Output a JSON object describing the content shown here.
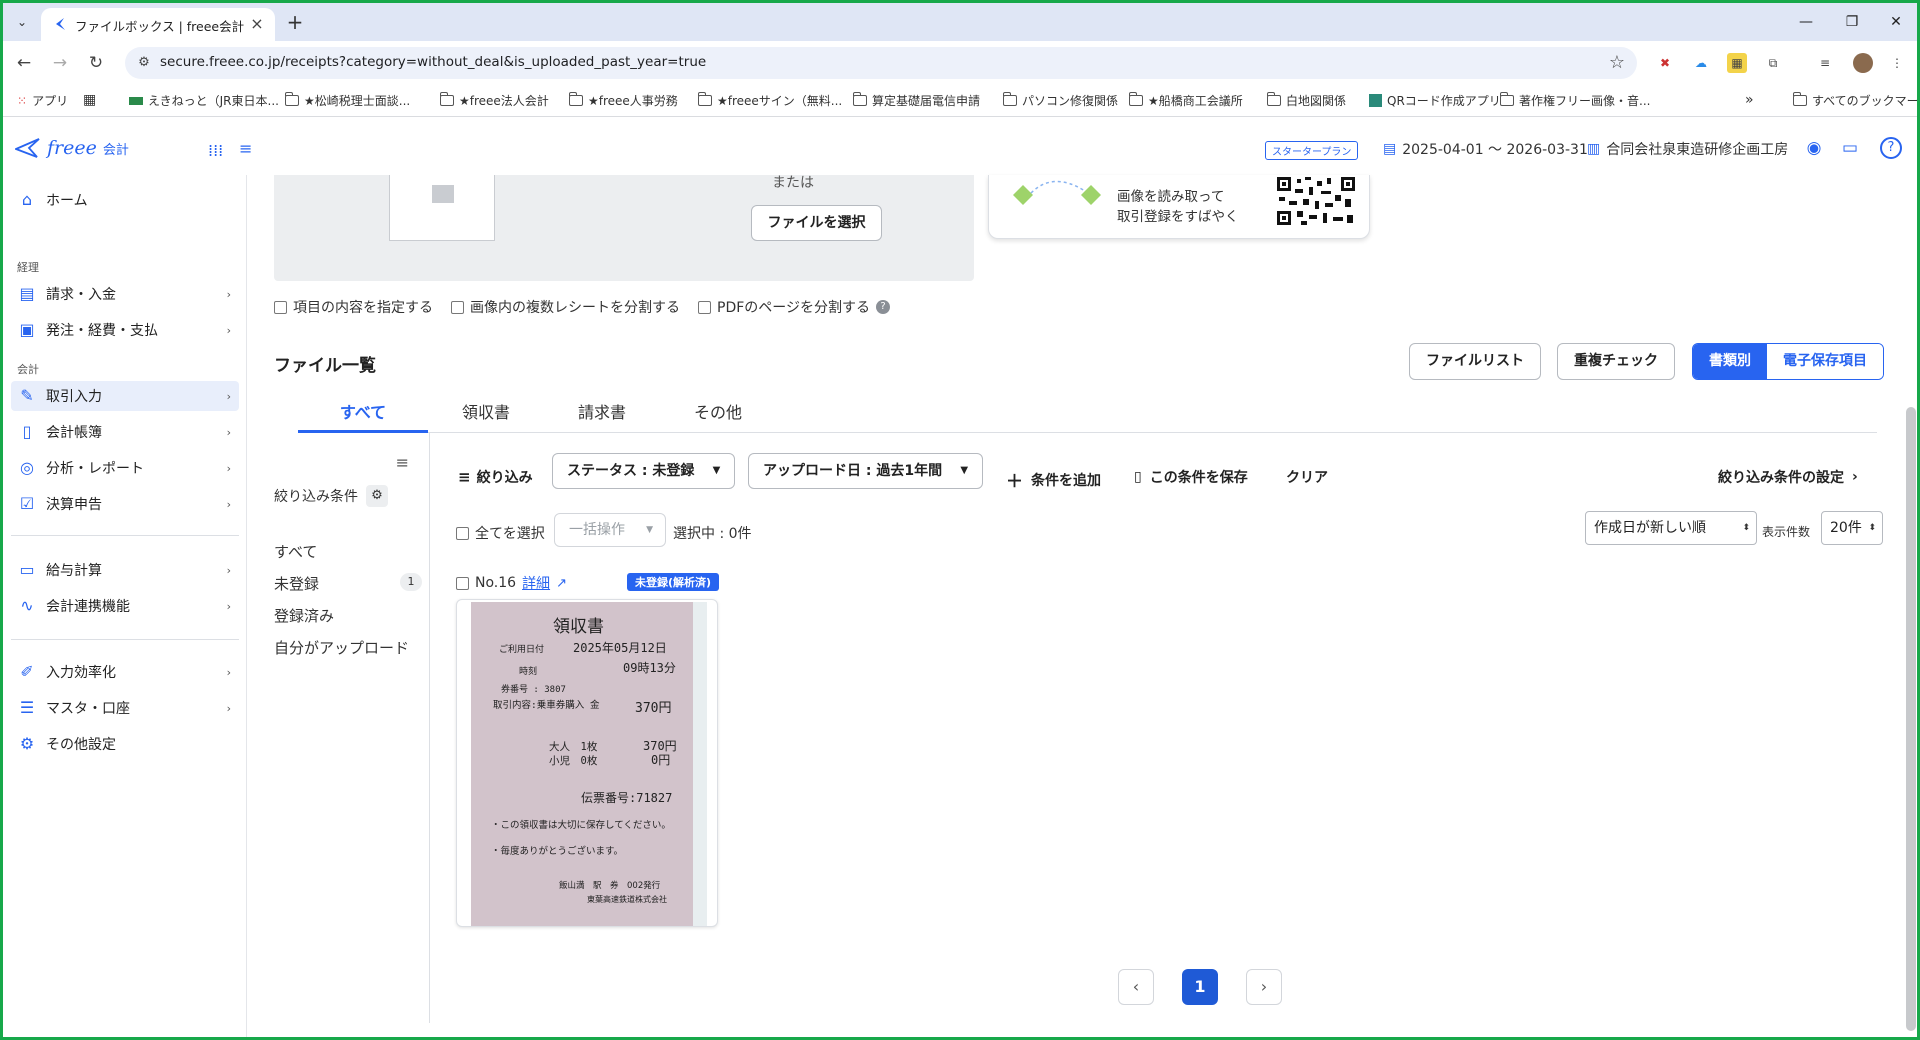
{
  "browser": {
    "tab_title": "ファイルボックス | freee会計",
    "url": "secure.freee.co.jp/receipts?category=without_deal&is_uploaded_past_year=true",
    "bookmarks": [
      "アプリ",
      "えきねっと（JR東日本...",
      "★松崎税理士面談...",
      "★freee法人会計",
      "★freee人事労務",
      "★freeeサイン（無料...",
      "算定基礎届電信申請",
      "パソコン修復関係",
      "★船橋商工会議所",
      "白地図関係",
      "QRコード作成アプリ",
      "著作権フリー画像・音..."
    ],
    "bookmarks_all": "すべてのブックマーク"
  },
  "header": {
    "logo": "freee",
    "logo_sub": "会計",
    "plan": "スタータープラン",
    "period": "2025-04-01 〜 2026-03-31",
    "company": "合同会社泉東造研修企画工房"
  },
  "sidebar": {
    "home": "ホーム",
    "section_keiri": "経理",
    "seikyu": "請求・入金",
    "hatchu": "発注・経費・支払",
    "section_kaikei": "会計",
    "torihiki": "取引入力",
    "choubo": "会計帳簿",
    "bunseki": "分析・レポート",
    "kessan": "決算申告",
    "kyuyo": "給与計算",
    "renkei": "会計連携機能",
    "kouritsu": "入力効率化",
    "master": "マスタ・口座",
    "sonota": "その他設定"
  },
  "upload": {
    "or": "または",
    "select_file": "ファイルを選択",
    "promo_line1": "画像を読み取って",
    "promo_line2": "取引登録をすばやく"
  },
  "options": {
    "opt1": "項目の内容を指定する",
    "opt2": "画像内の複数レシートを分割する",
    "opt3": "PDFのページを分割する"
  },
  "filelist": {
    "title": "ファイル一覧",
    "btn_filelist": "ファイルリスト",
    "btn_dup": "重複チェック",
    "seg_doc": "書類別",
    "seg_estore": "電子保存項目",
    "tabs": [
      "すべて",
      "領収書",
      "請求書",
      "その他"
    ]
  },
  "filters": {
    "head": "絞り込み条件",
    "items": [
      "すべて",
      "未登録",
      "登録済み",
      "自分がアップロード"
    ],
    "unregistered_count": "1"
  },
  "filterbar": {
    "filter": "絞り込み",
    "status": "ステータス : 未登録",
    "upload_date": "アップロード日 : 過去1年間",
    "add_cond": "条件を追加",
    "save_cond": "この条件を保存",
    "clear": "クリア",
    "settings": "絞り込み条件の設定"
  },
  "listctrl": {
    "select_all": "全てを選択",
    "bulk": "一括操作",
    "selected": "選択中 : 0件",
    "sort": "作成日が新しい順",
    "per_page_label": "表示件数",
    "per_page": "20件"
  },
  "card": {
    "no": "No.16",
    "detail": "詳細",
    "status": "未登録(解析済)"
  },
  "receipt": {
    "title": "領収書",
    "use_date_label": "ご利用日付",
    "use_date": "2025年05月12日",
    "time_label": "時刻",
    "time": "09時13分",
    "ticket_no": "券番号 : 3807",
    "content": "取引内容:乗車券購入 金",
    "amount": "370円",
    "adult": "大人　1枚",
    "adult_amt": "370円",
    "child": "小児　0枚",
    "child_amt": "0円",
    "slip_no": "伝票番号:71827",
    "note1": "・この領収書は大切に保存してください。",
    "note2": "・毎度ありがとうございます。",
    "issuer1": "飯山満　駅　券　002発行",
    "issuer2": "東葉高速鉄道株式会社"
  },
  "pagination": {
    "current": "1"
  },
  "colors": {
    "accent": "#2864f0",
    "frame": "#17a84a"
  }
}
